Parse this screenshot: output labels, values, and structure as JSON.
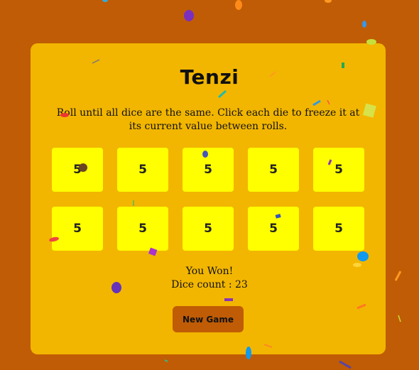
{
  "app": {
    "title": "Tenzi",
    "instructions": "Roll until all dice are the same. Click each die to freeze it at its current value between rolls."
  },
  "dice": [
    {
      "value": "5"
    },
    {
      "value": "5"
    },
    {
      "value": "5"
    },
    {
      "value": "5"
    },
    {
      "value": "5"
    },
    {
      "value": "5"
    },
    {
      "value": "5"
    },
    {
      "value": "5"
    },
    {
      "value": "5"
    },
    {
      "value": "5"
    }
  ],
  "status": {
    "message": "You Won!",
    "dice_count": "Dice count : 23"
  },
  "controls": {
    "new_game_label": "New Game"
  },
  "colors": {
    "background": "#c05c05",
    "card": "#f2b600",
    "die": "#ffff00"
  }
}
